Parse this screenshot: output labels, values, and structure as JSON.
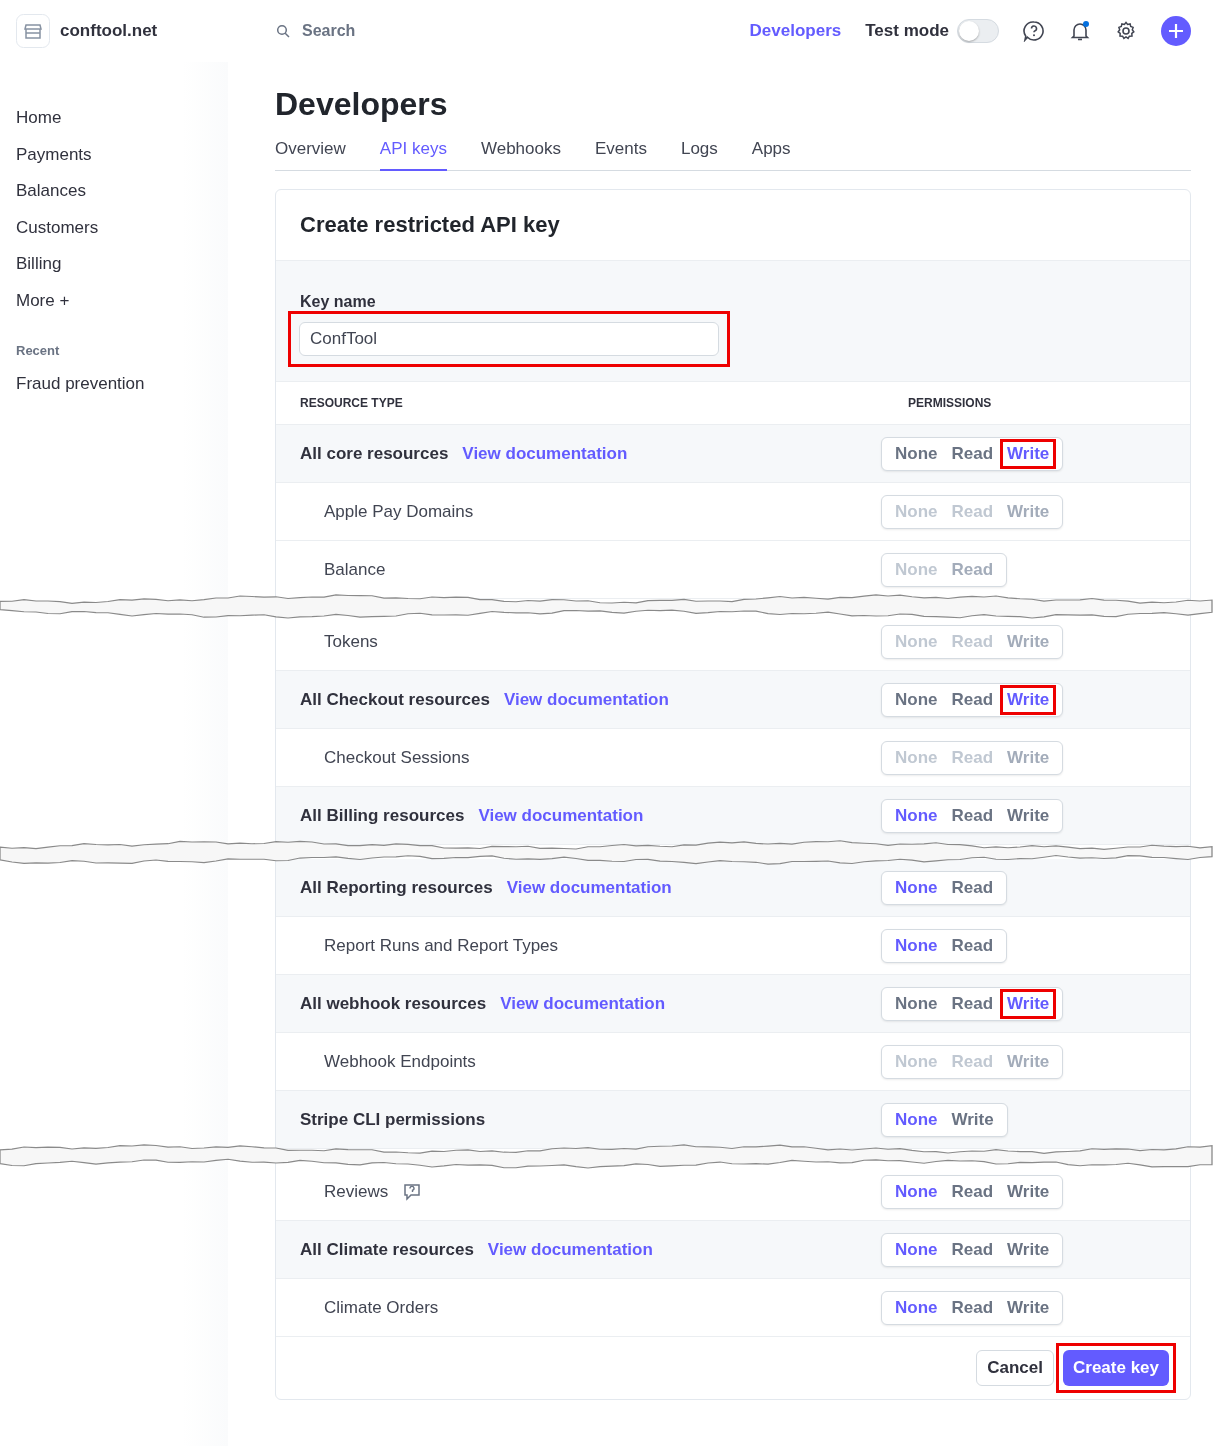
{
  "brand": {
    "name": "conftool.net"
  },
  "search": {
    "placeholder": "Search"
  },
  "topbar": {
    "developers_link": "Developers",
    "test_mode": {
      "label": "Test mode",
      "on": false
    },
    "notification_dot": true
  },
  "sidebar": {
    "items": [
      "Home",
      "Payments",
      "Balances",
      "Customers",
      "Billing"
    ],
    "more": {
      "label": "More",
      "icon": "+"
    },
    "recent_heading": "Recent",
    "recent_items": [
      "Fraud prevention"
    ]
  },
  "page": {
    "title": "Developers",
    "tabs": [
      {
        "label": "Overview",
        "selected": false
      },
      {
        "label": "API keys",
        "selected": true
      },
      {
        "label": "Webhooks",
        "selected": false
      },
      {
        "label": "Events",
        "selected": false
      },
      {
        "label": "Logs",
        "selected": false
      },
      {
        "label": "Apps",
        "selected": false
      }
    ]
  },
  "card": {
    "title": "Create restricted API key",
    "key_name": {
      "label": "Key name",
      "value": "ConfTool",
      "highlighted": true
    },
    "columns": [
      "RESOURCE TYPE",
      "PERMISSIONS"
    ],
    "sections": [
      {
        "rows": [
          {
            "kind": "group",
            "name": "All core resources",
            "link": "View documentation",
            "disabled": false,
            "options": [
              {
                "label": "None",
                "selected": false,
                "highlighted": false
              },
              {
                "label": "Read",
                "selected": false,
                "highlighted": false
              },
              {
                "label": "Write",
                "selected": true,
                "highlighted": true
              }
            ]
          },
          {
            "kind": "item",
            "name": "Apple Pay Domains",
            "disabled": true,
            "options": [
              {
                "label": "None",
                "selected": false,
                "highlighted": false
              },
              {
                "label": "Read",
                "selected": false,
                "highlighted": false
              },
              {
                "label": "Write",
                "selected": true,
                "highlighted": false
              }
            ]
          },
          {
            "kind": "item",
            "name": "Balance",
            "disabled": true,
            "options": [
              {
                "label": "None",
                "selected": false,
                "highlighted": false
              },
              {
                "label": "Read",
                "selected": true,
                "highlighted": false
              }
            ]
          }
        ]
      },
      {
        "rows": [
          {
            "kind": "item",
            "name": "Tokens",
            "disabled": true,
            "options": [
              {
                "label": "None",
                "selected": false,
                "highlighted": false
              },
              {
                "label": "Read",
                "selected": false,
                "highlighted": false
              },
              {
                "label": "Write",
                "selected": true,
                "highlighted": false
              }
            ]
          },
          {
            "kind": "group",
            "name": "All Checkout resources",
            "link": "View documentation",
            "disabled": false,
            "options": [
              {
                "label": "None",
                "selected": false,
                "highlighted": false
              },
              {
                "label": "Read",
                "selected": false,
                "highlighted": false
              },
              {
                "label": "Write",
                "selected": true,
                "highlighted": true
              }
            ]
          },
          {
            "kind": "item",
            "name": "Checkout Sessions",
            "disabled": true,
            "options": [
              {
                "label": "None",
                "selected": false,
                "highlighted": false
              },
              {
                "label": "Read",
                "selected": false,
                "highlighted": false
              },
              {
                "label": "Write",
                "selected": true,
                "highlighted": false
              }
            ]
          },
          {
            "kind": "group",
            "name": "All Billing resources",
            "link": "View documentation",
            "disabled": false,
            "options": [
              {
                "label": "None",
                "selected": true,
                "highlighted": false
              },
              {
                "label": "Read",
                "selected": false,
                "highlighted": false
              },
              {
                "label": "Write",
                "selected": false,
                "highlighted": false
              }
            ]
          }
        ]
      },
      {
        "rows": [
          {
            "kind": "group",
            "name": "All Reporting resources",
            "link": "View documentation",
            "disabled": false,
            "options": [
              {
                "label": "None",
                "selected": true,
                "highlighted": false
              },
              {
                "label": "Read",
                "selected": false,
                "highlighted": false
              }
            ]
          },
          {
            "kind": "item",
            "name": "Report Runs and Report Types",
            "disabled": false,
            "options": [
              {
                "label": "None",
                "selected": true,
                "highlighted": false
              },
              {
                "label": "Read",
                "selected": false,
                "highlighted": false
              }
            ]
          },
          {
            "kind": "group",
            "name": "All webhook resources",
            "link": "View documentation",
            "disabled": false,
            "options": [
              {
                "label": "None",
                "selected": false,
                "highlighted": false
              },
              {
                "label": "Read",
                "selected": false,
                "highlighted": false
              },
              {
                "label": "Write",
                "selected": true,
                "highlighted": true
              }
            ]
          },
          {
            "kind": "item",
            "name": "Webhook Endpoints",
            "disabled": true,
            "options": [
              {
                "label": "None",
                "selected": false,
                "highlighted": false
              },
              {
                "label": "Read",
                "selected": false,
                "highlighted": false
              },
              {
                "label": "Write",
                "selected": true,
                "highlighted": false
              }
            ]
          },
          {
            "kind": "group",
            "name": "Stripe CLI permissions",
            "disabled": false,
            "options": [
              {
                "label": "None",
                "selected": true,
                "highlighted": false
              },
              {
                "label": "Write",
                "selected": false,
                "highlighted": false
              }
            ]
          }
        ]
      },
      {
        "rows": [
          {
            "kind": "item",
            "name": "Reviews",
            "help_icon": true,
            "disabled": false,
            "options": [
              {
                "label": "None",
                "selected": true,
                "highlighted": false
              },
              {
                "label": "Read",
                "selected": false,
                "highlighted": false
              },
              {
                "label": "Write",
                "selected": false,
                "highlighted": false
              }
            ]
          },
          {
            "kind": "group",
            "name": "All Climate resources",
            "link": "View documentation",
            "disabled": false,
            "options": [
              {
                "label": "None",
                "selected": true,
                "highlighted": false
              },
              {
                "label": "Read",
                "selected": false,
                "highlighted": false
              },
              {
                "label": "Write",
                "selected": false,
                "highlighted": false
              }
            ]
          },
          {
            "kind": "item",
            "name": "Climate Orders",
            "disabled": false,
            "options": [
              {
                "label": "None",
                "selected": true,
                "highlighted": false
              },
              {
                "label": "Read",
                "selected": false,
                "highlighted": false
              },
              {
                "label": "Write",
                "selected": false,
                "highlighted": false
              }
            ]
          }
        ]
      }
    ],
    "footer": {
      "cancel": "Cancel",
      "create": {
        "label": "Create key",
        "highlighted": true
      }
    }
  }
}
